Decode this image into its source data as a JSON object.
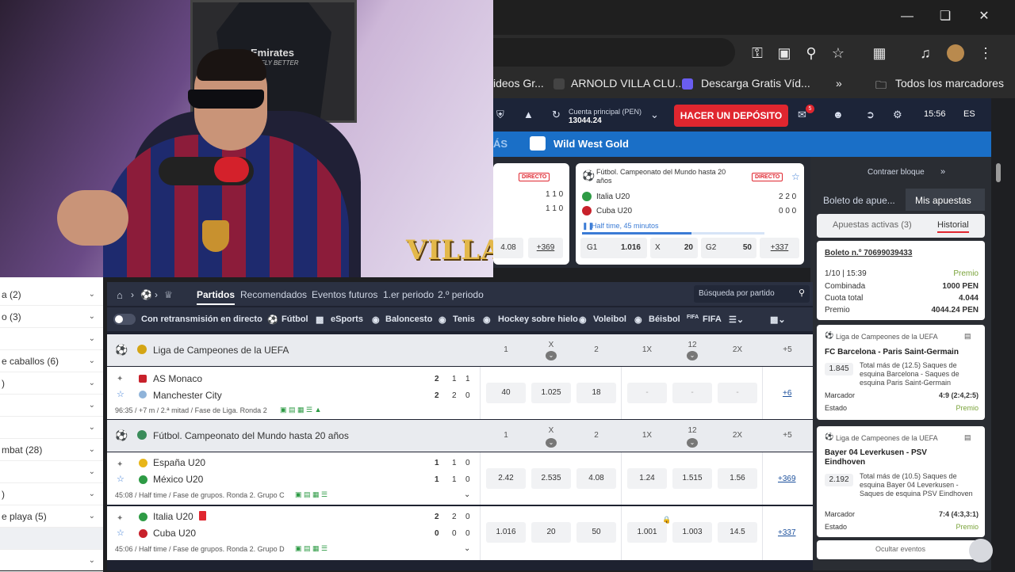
{
  "browser": {
    "bookmarks": [
      "ideos Gr...",
      "ARNOLD VILLA CLU...",
      "Descarga Gratis Víd...",
      "Todos los marcadores"
    ]
  },
  "header": {
    "account_label": "Cuenta principal (PEN)",
    "balance": "13044.24",
    "deposit_button": "HACER UN DEPÓSITO",
    "time": "15:56",
    "language": "ES",
    "notif_count": "5"
  },
  "promo": {
    "left_text": "ÁS",
    "title": "Wild West Gold"
  },
  "top_cards": [
    {
      "badge": "DIRECTO",
      "scores": [
        "1 1 0",
        "1 1 0"
      ],
      "odds": [
        "4.08",
        "+369"
      ]
    },
    {
      "title": "Fútbol. Campeonato del Mundo hasta 20 años",
      "badge": "DIRECTO",
      "team1": "Italia U20",
      "team2": "Cuba U20",
      "scores": [
        "2 2 0",
        "0 0 0"
      ],
      "status": "Half time, 45 minutos",
      "odds_labels": [
        "G1",
        "X",
        "G2"
      ],
      "odds": [
        "1.016",
        "20",
        "50",
        "+337"
      ]
    }
  ],
  "sidebar": {
    "contract": "Contraer bloque",
    "tabs": [
      "Boleto de apue...",
      "Mis apuestas"
    ],
    "subtabs": [
      "Apuestas activas (3)",
      "Historial"
    ],
    "ticket_label": "Boleto n.º 70699039433",
    "ticket_date": "1/10 | 15:39",
    "ticket_prize_label": "Premio",
    "rows": [
      {
        "label": "Combinada",
        "value": "1000 PEN"
      },
      {
        "label": "Cuota total",
        "value": "4.044"
      },
      {
        "label": "Premio",
        "value": "4044.24 PEN"
      }
    ],
    "bets": [
      {
        "league": "Liga de Campeones de la UEFA",
        "match": "FC Barcelona - Paris Saint-Germain",
        "odd": "1.845",
        "desc": "Total más de (12.5) Saques de esquina Barcelona - Saques de esquina Paris Saint-Germain",
        "marcador_label": "Marcador",
        "marcador": "4:9 (2:4,2:5)",
        "estado_label": "Estado",
        "estado": "Premio"
      },
      {
        "league": "Liga de Campeones de la UEFA",
        "match": "Bayer 04 Leverkusen - PSV Eindhoven",
        "odd": "2.192",
        "desc": "Total más de (10.5) Saques de esquina Bayer 04 Leverkusen - Saques de esquina PSV Eindhoven",
        "marcador_label": "Marcador",
        "marcador": "7:4 (4:3,3:1)",
        "estado_label": "Estado",
        "estado": "Premio"
      }
    ],
    "hide_events": "Ocultar eventos"
  },
  "left_list": [
    "a (2)",
    "o (3)",
    "",
    "e caballos (6)",
    ")",
    "",
    "",
    "mbat (28)",
    "",
    ")",
    "e playa (5)",
    "",
    ""
  ],
  "nav": {
    "tabs": [
      "Partidos",
      "Recomendados",
      "Eventos futuros",
      "1.er periodo",
      "2.º periodo"
    ],
    "search_placeholder": "Búsqueda por partido",
    "live_toggle": "Con retransmisión en directo",
    "sports": [
      "Fútbol",
      "eSports",
      "Baloncesto",
      "Tenis",
      "Hockey sobre hielo",
      "Voleibol",
      "Béisbol",
      "FIFA"
    ]
  },
  "columns": [
    "1",
    "X",
    "2",
    "1X",
    "12",
    "2X"
  ],
  "sections": [
    {
      "league": "Liga de Campeones de la UEFA",
      "more": "+5",
      "matches": [
        {
          "team1": "AS Monaco",
          "team2": "Manchester City",
          "s1": [
            "2",
            "1",
            "1"
          ],
          "s2": [
            "2",
            "2",
            "0"
          ],
          "meta": "96:35 / +7 m / 2.ª mitad / Fase de Liga. Ronda 2",
          "odds": [
            "40",
            "1.025",
            "18",
            "-",
            "-",
            "-"
          ],
          "more": "+6"
        }
      ]
    },
    {
      "league": "Fútbol. Campeonato del Mundo hasta 20 años",
      "more": "+5",
      "matches": [
        {
          "team1": "España U20",
          "team2": "México U20",
          "s1": [
            "1",
            "1",
            "0"
          ],
          "s2": [
            "1",
            "1",
            "0"
          ],
          "meta": "45:08 / Half time / Fase de grupos. Ronda 2. Grupo C",
          "odds": [
            "2.42",
            "2.535",
            "4.08",
            "1.24",
            "1.515",
            "1.56"
          ],
          "more": "+369"
        },
        {
          "team1": "Italia U20",
          "team2": "Cuba U20",
          "s1": [
            "2",
            "2",
            "0"
          ],
          "s2": [
            "0",
            "0",
            "0"
          ],
          "meta": "45:06 / Half time / Fase de grupos. Ronda 2. Grupo D",
          "odds": [
            "1.016",
            "20",
            "50",
            "1.001",
            "1.003",
            "14.5"
          ],
          "more": "+337"
        }
      ]
    }
  ],
  "webcam": {
    "shirt_text": "Emirates",
    "shirt_sub": "FLY BETTER",
    "logo": "VILLA"
  }
}
